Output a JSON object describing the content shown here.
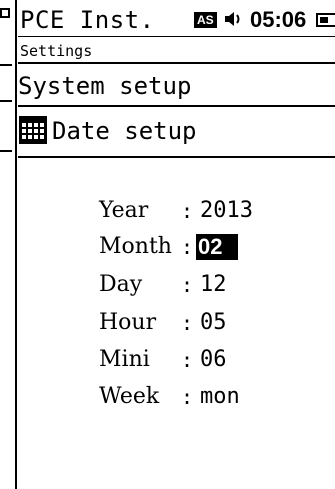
{
  "status_bar": {
    "title": "PCE Inst.",
    "mode_badge": "AS",
    "time": "05:06",
    "icons": [
      "speaker-icon",
      "battery-icon"
    ]
  },
  "breadcrumb": "Settings",
  "menu": {
    "parent": "System setup",
    "current": "Date setup",
    "current_icon": "calendar-icon"
  },
  "fields": [
    {
      "label": "Year",
      "value": "2013",
      "selected": false
    },
    {
      "label": "Month",
      "value": "02",
      "selected": true
    },
    {
      "label": "Day",
      "value": "12",
      "selected": false
    },
    {
      "label": "Hour",
      "value": "05",
      "selected": false
    },
    {
      "label": "Mini",
      "value": "06",
      "selected": false
    },
    {
      "label": "Week",
      "value": "mon",
      "selected": false
    }
  ],
  "colors": {
    "foreground": "#000000",
    "background": "#ffffff",
    "highlight": "#000000"
  }
}
